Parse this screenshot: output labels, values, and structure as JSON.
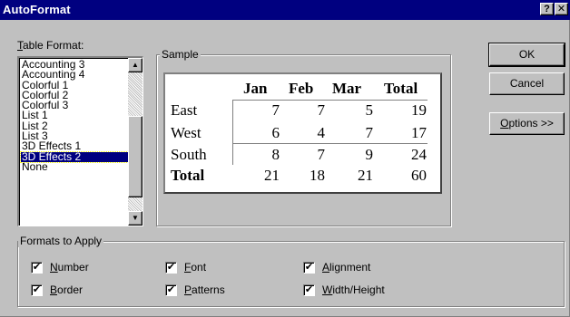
{
  "window": {
    "title": "AutoFormat",
    "help_button": "?",
    "close_button": "✕"
  },
  "table_format": {
    "label": "Table Format:",
    "items": [
      "Accounting 3",
      "Accounting 4",
      "Colorful 1",
      "Colorful 2",
      "Colorful 3",
      "List 1",
      "List 2",
      "List 3",
      "3D Effects 1",
      "3D Effects 2",
      "None"
    ],
    "selected": "3D Effects 2",
    "scroll_up_icon": "▲",
    "scroll_down_icon": "▼"
  },
  "sample": {
    "label": "Sample",
    "columns": [
      "Jan",
      "Feb",
      "Mar",
      "Total"
    ],
    "rows": [
      {
        "name": "East",
        "values": [
          "7",
          "7",
          "5",
          "19"
        ]
      },
      {
        "name": "West",
        "values": [
          "6",
          "4",
          "7",
          "17"
        ]
      },
      {
        "name": "South",
        "values": [
          "8",
          "7",
          "9",
          "24"
        ]
      },
      {
        "name": "Total",
        "values": [
          "21",
          "18",
          "21",
          "60"
        ]
      }
    ]
  },
  "buttons": {
    "ok": "OK",
    "cancel": "Cancel",
    "options": "Options >>"
  },
  "formats_to_apply": {
    "label": "Formats to Apply",
    "check_mark": "✔",
    "options": [
      {
        "label": "Number",
        "checked": true
      },
      {
        "label": "Font",
        "checked": true
      },
      {
        "label": "Alignment",
        "checked": true
      },
      {
        "label": "Border",
        "checked": true
      },
      {
        "label": "Patterns",
        "checked": true
      },
      {
        "label": "Width/Height",
        "checked": true
      }
    ]
  },
  "colors": {
    "title_bar": "#000080",
    "dialog_face": "#c0c0c0",
    "selection": "#000080"
  }
}
